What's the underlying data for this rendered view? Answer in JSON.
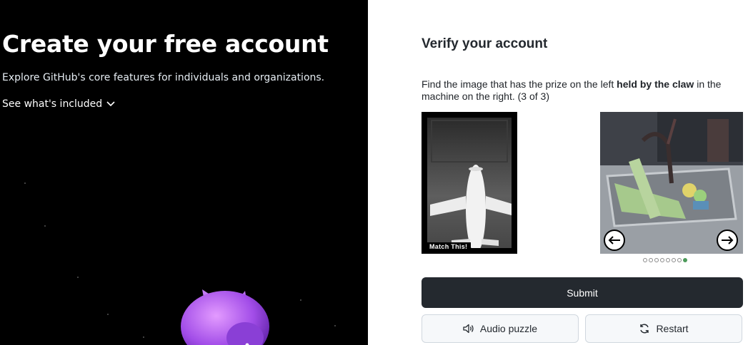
{
  "signup": {
    "title": "Create your free account",
    "subtitle": "Explore GitHub's core features for individuals and organizations.",
    "see_included": "See what's included"
  },
  "verify": {
    "title": "Verify your account",
    "instruction_pre": "Find the image that has the prize on the left ",
    "instruction_bold": "held by the claw",
    "instruction_post": " in the machine on the right. (3 of 3)",
    "match_label": "Match This!",
    "pager": {
      "total": 8,
      "current": 8
    },
    "submit_label": "Submit",
    "audio_label": "Audio puzzle",
    "restart_label": "Restart"
  },
  "icons": {
    "chevron": "chevron-down-icon",
    "prev": "arrow-left-icon",
    "next": "arrow-right-icon",
    "audio": "speaker-icon",
    "restart": "refresh-icon"
  },
  "colors": {
    "accent_dark": "#24292f",
    "active_dot": "#4c9a5a"
  }
}
